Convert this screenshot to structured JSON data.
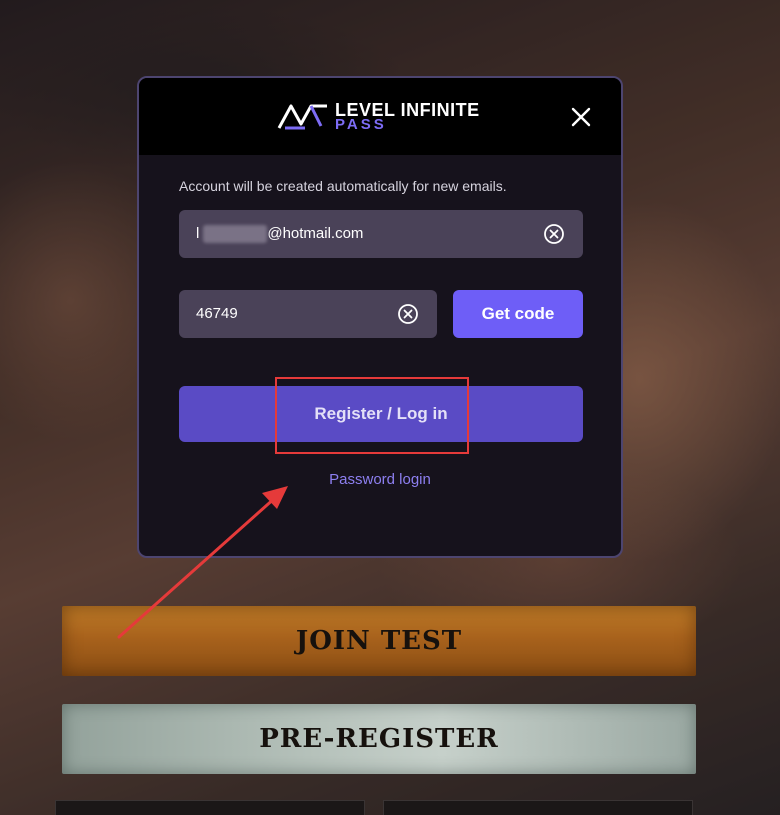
{
  "brand": {
    "line1": "LEVEL INFINITE",
    "line2": "PASS",
    "accent_color": "#7d6cf5"
  },
  "modal": {
    "notice": "Account will be created automatically for new emails.",
    "email": {
      "value_prefix": "l",
      "value_suffix": "@hotmail.com",
      "clear_icon": "circle-x-icon"
    },
    "code": {
      "value": "46749",
      "clear_icon": "circle-x-icon"
    },
    "get_code_label": "Get code",
    "register_label": "Register / Log in",
    "password_login_label": "Password login",
    "close_icon": "close-icon"
  },
  "page": {
    "join_test_label": "JOIN TEST",
    "pre_register_label": "PRE-REGISTER"
  },
  "colors": {
    "primary_button": "#6e5ef7",
    "register_button": "#5a4bc5",
    "annotation_red": "#e53a3a"
  }
}
